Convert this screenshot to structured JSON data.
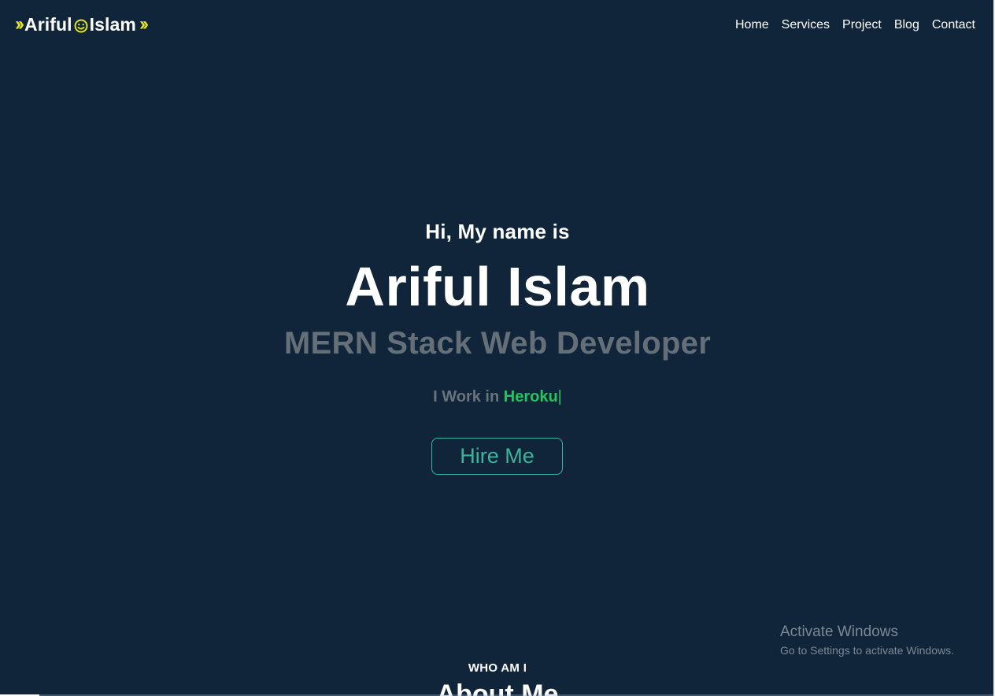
{
  "logo": {
    "first": "Ariful",
    "last": "Islam",
    "accent_color": "#e5e51c",
    "left_icon": "double-chevron-right-icon",
    "middle_icon": "smiley-icon",
    "right_icon": "double-chevron-right-icon"
  },
  "nav": {
    "items": [
      {
        "label": "Home"
      },
      {
        "label": "Services"
      },
      {
        "label": "Project"
      },
      {
        "label": "Blog"
      },
      {
        "label": "Contact"
      }
    ]
  },
  "hero": {
    "greeting": "Hi, My name is",
    "name": "Ariful Islam",
    "role": "MERN Stack Web Developer",
    "work_prefix": "I Work in",
    "work_highlight": "Heroku",
    "cursor": "|",
    "button_label": "Hire Me",
    "highlight_color": "#22c55e",
    "button_color": "#38b59b"
  },
  "about": {
    "eyebrow": "WHO AM I",
    "title": "About Me"
  },
  "watermark": {
    "title": "Activate Windows",
    "subtitle": "Go to Settings to activate Windows."
  },
  "colors": {
    "background": "#10253a",
    "role_text": "#656f78"
  }
}
